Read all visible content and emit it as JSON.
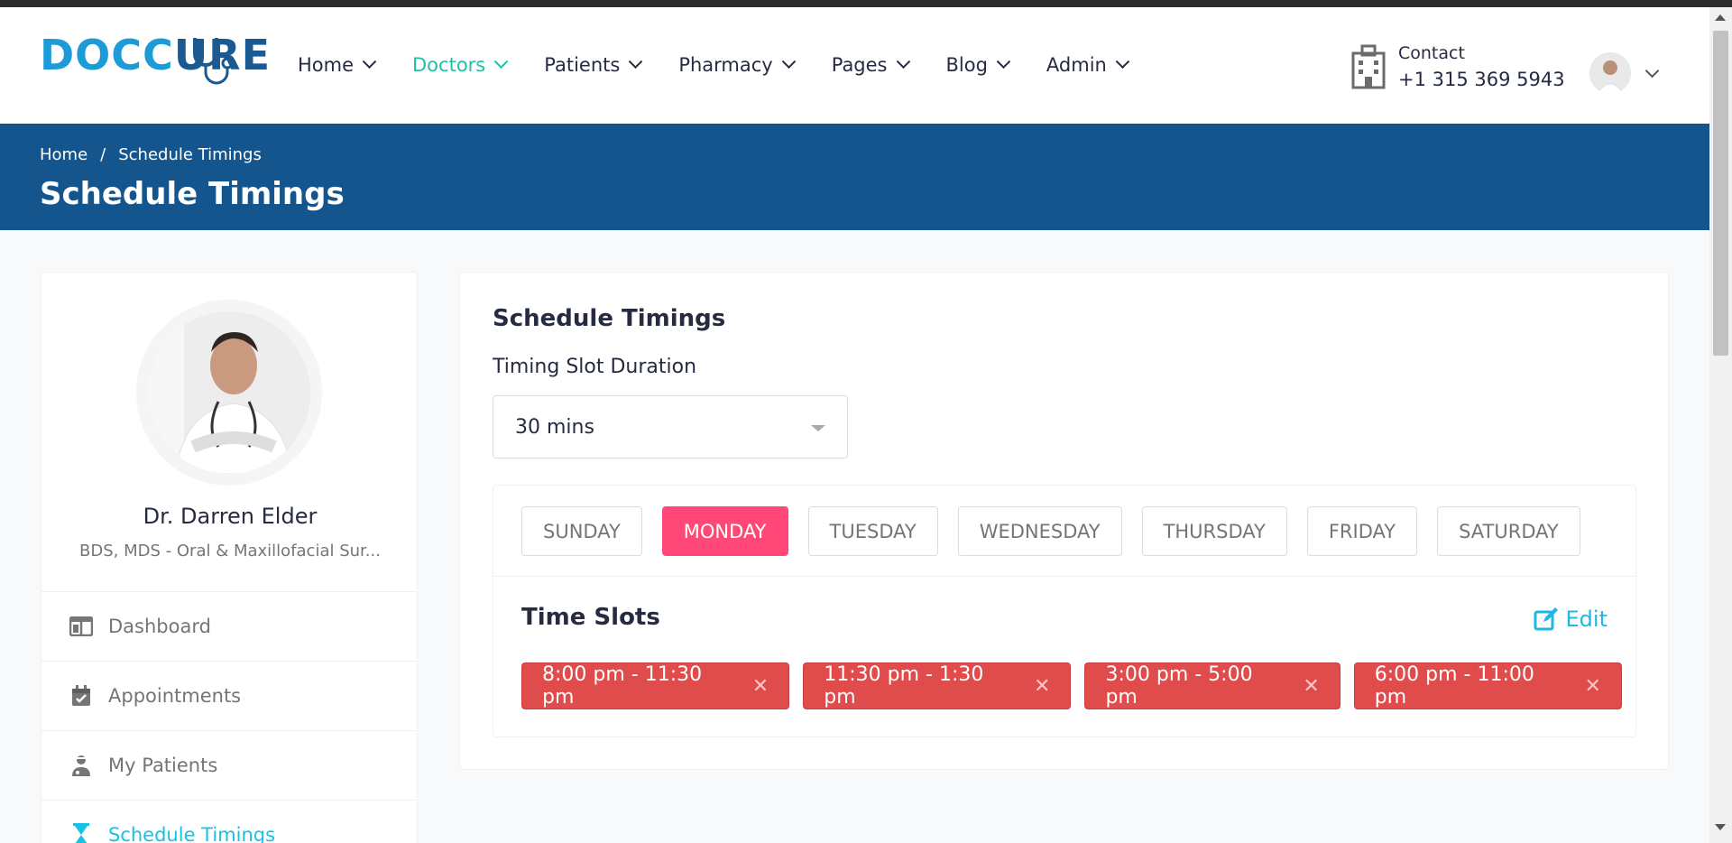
{
  "brand": {
    "logo_part1": "DOCC",
    "logo_part2": "URE"
  },
  "nav": {
    "items": [
      {
        "label": "Home"
      },
      {
        "label": "Doctors"
      },
      {
        "label": "Patients"
      },
      {
        "label": "Pharmacy"
      },
      {
        "label": "Pages"
      },
      {
        "label": "Blog"
      },
      {
        "label": "Admin"
      }
    ],
    "active": "Doctors"
  },
  "contact": {
    "label": "Contact",
    "phone": "+1 315 369 5943"
  },
  "breadcrumb": {
    "home": "Home",
    "separator": "/",
    "current": "Schedule Timings"
  },
  "page_title": "Schedule Timings",
  "sidebar": {
    "doctor_name": "Dr. Darren Elder",
    "specialty": "BDS, MDS - Oral & Maxillofacial Sur...",
    "items": [
      {
        "label": "Dashboard",
        "icon": "columns-icon"
      },
      {
        "label": "Appointments",
        "icon": "calendar-check-icon"
      },
      {
        "label": "My Patients",
        "icon": "user-injured-icon"
      },
      {
        "label": "Schedule Timings",
        "icon": "hourglass-icon"
      }
    ],
    "active": "Schedule Timings"
  },
  "main": {
    "title": "Schedule Timings",
    "slot_duration_label": "Timing Slot Duration",
    "slot_duration_value": "30 mins",
    "days": [
      "SUNDAY",
      "MONDAY",
      "TUESDAY",
      "WEDNESDAY",
      "THURSDAY",
      "FRIDAY",
      "SATURDAY"
    ],
    "active_day": "MONDAY",
    "time_slots_title": "Time Slots",
    "edit_label": "Edit",
    "slots": [
      "8:00 pm - 11:30 pm",
      "11:30 pm - 1:30 pm",
      "3:00 pm - 5:00 pm",
      "6:00 pm - 11:00 pm"
    ]
  },
  "colors": {
    "brand_blue": "#1c9bd7",
    "banner": "#15558d",
    "accent_green": "#20c0a3",
    "active_day": "#ff4877",
    "slot_red": "#e04b4b",
    "link_blue": "#1db9e6"
  }
}
